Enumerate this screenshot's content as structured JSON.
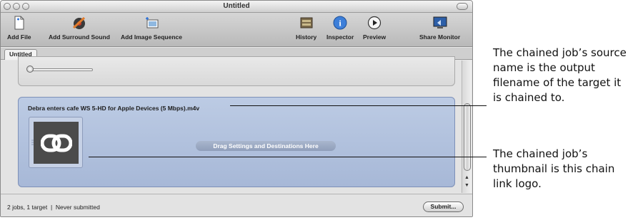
{
  "window": {
    "title": "Untitled"
  },
  "toolbar": {
    "add_file": "Add File",
    "add_surround_sound": "Add Surround Sound",
    "add_image_sequence": "Add Image Sequence",
    "history": "History",
    "inspector": "Inspector",
    "preview": "Preview",
    "share_monitor": "Share Monitor"
  },
  "tabs": [
    {
      "label": "Untitled"
    }
  ],
  "job": {
    "name": "Debra enters cafe WS 5-HD for Apple Devices (5 Mbps).m4v",
    "drop_hint": "Drag Settings and Destinations Here"
  },
  "status": {
    "summary": "2 jobs, 1 target",
    "separator": "|",
    "state": "Never submitted",
    "submit_label": "Submit..."
  },
  "callouts": [
    {
      "lines": [
        "The chained job’s source",
        "name is the output",
        "filename of the target it",
        "is chained to."
      ]
    },
    {
      "lines": [
        "The chained job’s",
        "thumbnail is this chain",
        "link logo."
      ]
    }
  ]
}
